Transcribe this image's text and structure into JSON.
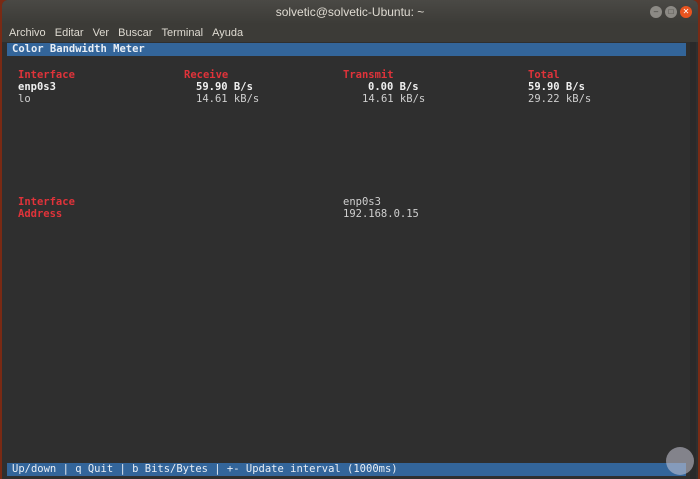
{
  "window": {
    "title": "solvetic@solvetic-Ubuntu: ~"
  },
  "menu": [
    "Archivo",
    "Editar",
    "Ver",
    "Buscar",
    "Terminal",
    "Ayuda"
  ],
  "app": {
    "title": "Color Bandwidth Meter"
  },
  "table": {
    "headers": [
      "Interface",
      "Receive",
      "Transmit",
      "Total"
    ],
    "rows": [
      {
        "iface": "enp0s3",
        "receive": "59.90 B/s",
        "transmit": "0.00 B/s",
        "total": "59.90 B/s"
      },
      {
        "iface": "lo",
        "receive": "14.61 kB/s",
        "transmit": "14.61 kB/s",
        "total": "29.22 kB/s"
      }
    ]
  },
  "details": {
    "interface_label": "Interface",
    "interface_value": "enp0s3",
    "address_label": "Address",
    "address_value": "192.168.0.15"
  },
  "footer": "Up/down | q Quit | b Bits/Bytes | +- Update interval (1000ms)"
}
